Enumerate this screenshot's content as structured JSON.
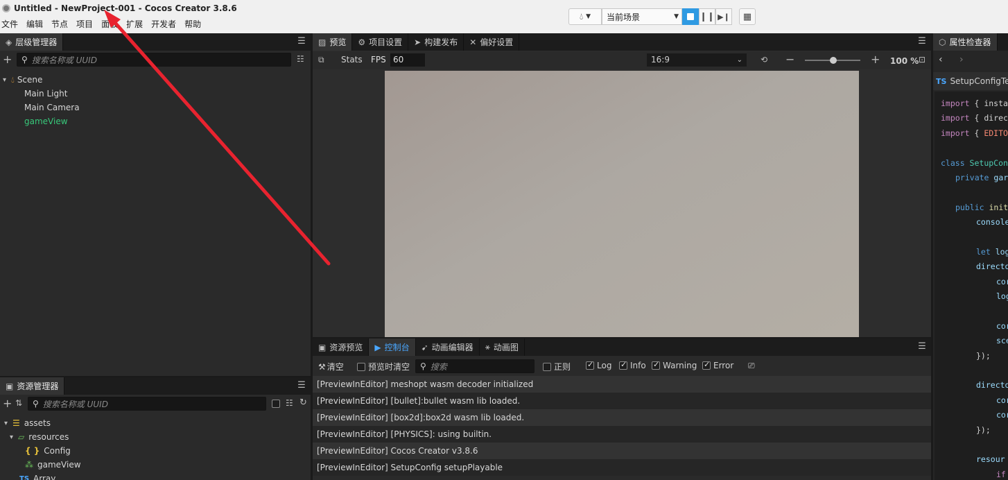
{
  "window": {
    "title": "Untitled - NewProject-001 - Cocos Creator 3.8.6"
  },
  "menu": [
    "文件",
    "编辑",
    "节点",
    "项目",
    "面板",
    "扩展",
    "开发者",
    "帮助"
  ],
  "toolbar": {
    "scene_select": "当前场景"
  },
  "hierarchy": {
    "tab": "层级管理器",
    "search_placeholder": "搜索名称或 UUID",
    "scene": "Scene",
    "nodes": [
      "Main Light",
      "Main Camera",
      "gameView"
    ]
  },
  "assets": {
    "tab": "资源管理器",
    "search_placeholder": "搜索名称或 UUID",
    "root": "assets",
    "folder": "resources",
    "items": [
      "Config",
      "gameView",
      "Array"
    ]
  },
  "preview": {
    "tabs": [
      "预览",
      "项目设置",
      "构建发布",
      "偏好设置"
    ],
    "stats_label": "Stats",
    "fps_label": "FPS",
    "fps_value": "60",
    "ratio": "16:9",
    "zoom": "100 %"
  },
  "bottom": {
    "tabs": [
      "资源预览",
      "控制台",
      "动画编辑器",
      "动画图"
    ],
    "clear_label": "清空",
    "clear_on_preview": "预览时清空",
    "search_placeholder": "搜索",
    "regex_label": "正则",
    "filters": [
      "Log",
      "Info",
      "Warning",
      "Error"
    ],
    "logs": [
      "[PreviewInEditor] meshopt wasm decoder initialized",
      "[PreviewInEditor] [bullet]:bullet wasm lib loaded.",
      "[PreviewInEditor] [box2d]:box2d wasm lib loaded.",
      "[PreviewInEditor] [PHYSICS]: using builtin.",
      "[PreviewInEditor] Cocos Creator v3.8.6",
      "[PreviewInEditor] SetupConfig setupPlayable"
    ]
  },
  "inspector": {
    "tab": "属性检查器",
    "file_badge": "TS",
    "file_name": "SetupConfigTes",
    "code": {
      "l1_kw": "import",
      "l1_rest": " { insta",
      "l2_kw": "import",
      "l2_rest": " { direc",
      "l3_kw": "import",
      "l3_open": " { ",
      "l3_id": "EDITO",
      "l4_kw": "class",
      "l4_name": " SetupCon",
      "l5_kw": "private",
      "l5_rest": " gar",
      "l6_kw": "public",
      "l6_fn": " init",
      "l7": "console",
      "l8_kw": "let",
      "l8_rest": " log",
      "l9": "directo",
      "l10": "cor",
      "l11": "log",
      "l12": "cor",
      "l13": "sce",
      "l14": "});",
      "l15": "directo",
      "l16": "cor",
      "l17": "cor",
      "l18": "});",
      "l19": "resour",
      "l20": "if"
    }
  },
  "colors": {
    "accent": "#2f9ae2",
    "active_tab": "#4aa7ff",
    "node_green": "#38c87a",
    "arrow": "#e8232f"
  }
}
